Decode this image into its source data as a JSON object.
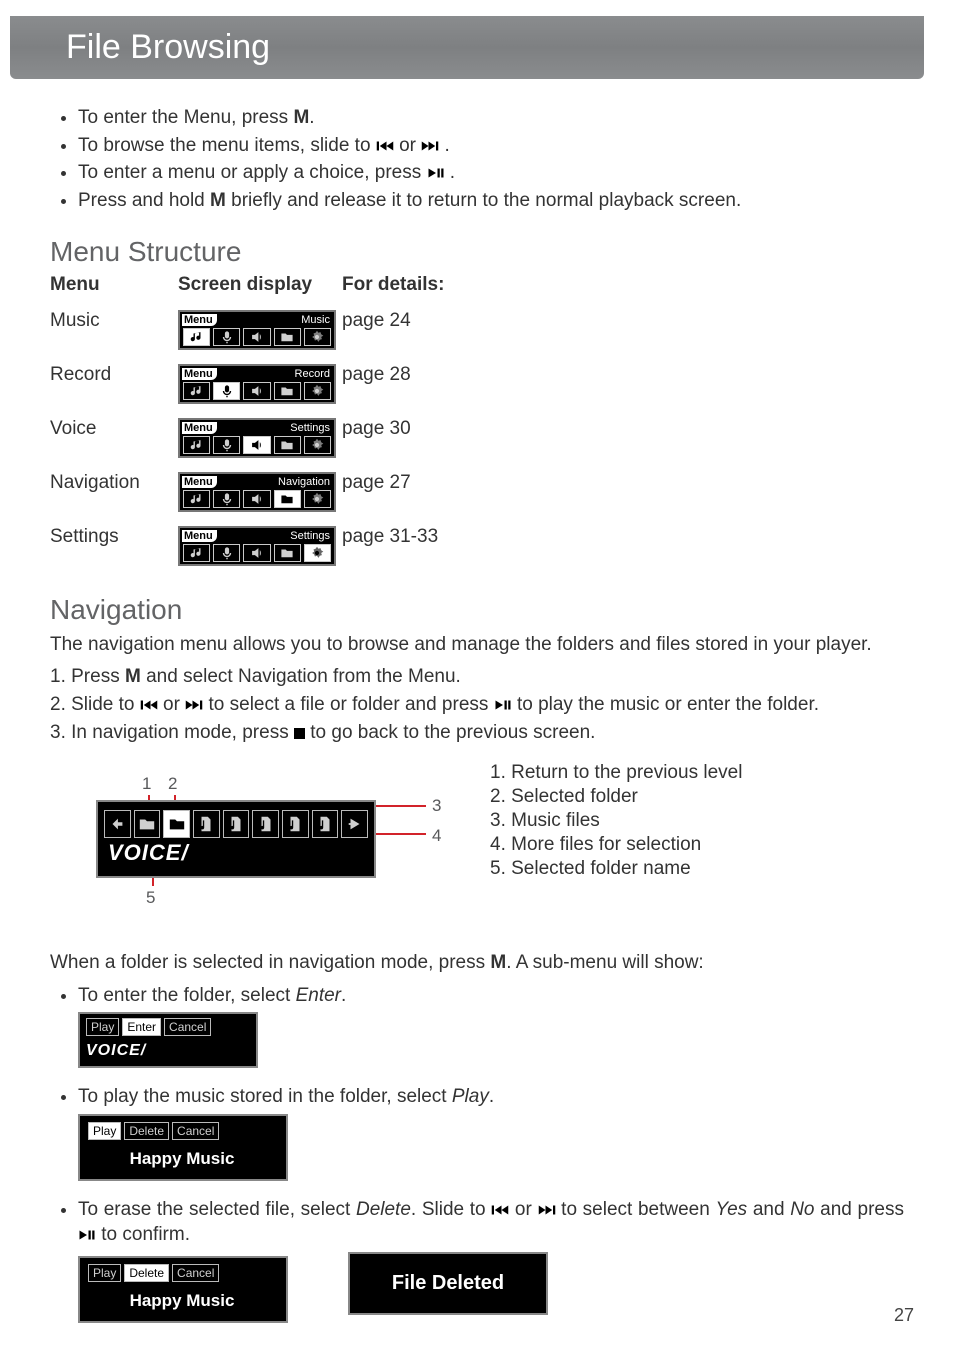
{
  "title": "File Browsing",
  "page_number": "27",
  "intro_bullets": [
    {
      "pre": "To enter the Menu, press ",
      "bold": "M",
      "post": "."
    },
    {
      "pre": "To browse the menu items, slide to ",
      "bold": "",
      "post": "",
      "slide": true
    },
    {
      "pre": "To enter a menu or apply a choice, press ",
      "bold": "",
      "post": "",
      "play": true
    },
    {
      "pre": "Press and hold ",
      "bold": "M",
      "post": " briefly and release it to return to the normal playback screen."
    }
  ],
  "menu_structure": {
    "heading": "Menu Structure",
    "cols": [
      "Menu",
      "Screen display",
      "For details:"
    ],
    "rows": [
      {
        "name": "Music",
        "screen": "Music",
        "active": 0,
        "page": "page 24"
      },
      {
        "name": "Record",
        "screen": "Record",
        "active": 1,
        "page": "page 28"
      },
      {
        "name": "Voice",
        "screen": "Settings",
        "active": 2,
        "page": "page 30"
      },
      {
        "name": "Navigation",
        "screen": "Navigation",
        "active": 3,
        "page": "page 27"
      },
      {
        "name": "Settings",
        "screen": "Settings",
        "active": 4,
        "page": "page 31-33"
      }
    ],
    "menu_tag": "Menu"
  },
  "navigation": {
    "heading": "Navigation",
    "intro": "The navigation menu allows you to browse and manage the folders and files stored in your player.",
    "steps": [
      {
        "n": "1.",
        "pre": "Press ",
        "bold": "M",
        "post": " and select Navigation from the Menu."
      },
      {
        "n": "2.",
        "slidefile": true
      },
      {
        "n": "3.",
        "stop": true,
        "text": "In navigation mode, press ",
        "post2": " to go back to the previous screen."
      }
    ],
    "callouts": [
      "1",
      "2",
      "3",
      "4",
      "5"
    ],
    "legend": [
      "1.  Return to the previous level",
      "2.  Selected folder",
      "3.  Music files",
      "4.  More files for selection",
      "5.  Selected folder name"
    ],
    "folder_label": "VOICE/"
  },
  "submenu": {
    "intro_pre": "When a folder is selected in navigation mode, press ",
    "intro_bold": "M",
    "intro_post": ". A sub-menu will show:",
    "items": [
      {
        "text_pre": "To enter the folder, select ",
        "text_em": "Enter",
        "text_post": ".",
        "lcd": {
          "btns": [
            "Play",
            "Enter",
            "Cancel"
          ],
          "sel": 1,
          "label": "VOICE/"
        }
      },
      {
        "text_pre": "To play the music stored in the folder, select ",
        "text_em": "Play",
        "text_post": ".",
        "lcd": {
          "btns": [
            "Play",
            "Delete",
            "Cancel"
          ],
          "sel": 0,
          "title": "Happy Music"
        }
      },
      {
        "text_pre": "To erase the selected file, select ",
        "text_em": "Delete",
        "text_post": ". Slide to ",
        "slide": true,
        "tail": " to select between ",
        "tail_em1": "Yes",
        "tail_mid": " and ",
        "tail_em2": "No",
        "tail2": " and press ",
        "play": true,
        "tail3": " to confirm.",
        "lcd": {
          "btns": [
            "Play",
            "Delete",
            "Cancel"
          ],
          "sel": 1,
          "title": "Happy Music"
        },
        "extra_box_label": "File Deleted"
      }
    ]
  }
}
